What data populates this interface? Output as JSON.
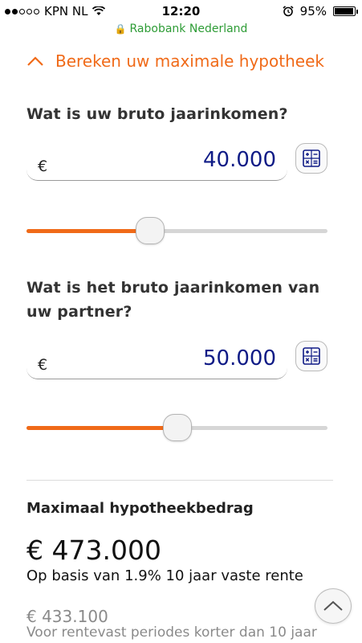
{
  "status_bar": {
    "carrier": "KPN NL",
    "time": "12:20",
    "battery": "95%",
    "battery_level": 0.95
  },
  "url_bar": {
    "site": "Rabobank Nederland"
  },
  "colors": {
    "accent": "#f06a18",
    "value_blue": "#0f1b86",
    "secure_green": "#2e9c36"
  },
  "section": {
    "title": "Bereken uw maximale hypotheek"
  },
  "income": {
    "question": "Wat is uw bruto jaarinkomen?",
    "currency": "€",
    "value": "40.000",
    "slider_fraction": 0.41
  },
  "partner_income": {
    "question": "Wat is het bruto jaarinkomen van uw partner?",
    "currency": "€",
    "value": "50.000",
    "slider_fraction": 0.5
  },
  "result": {
    "title": "Maximaal hypotheekbedrag",
    "amount": "€ 473.000",
    "basis": "Op basis van 1.9% 10 jaar vaste rente",
    "alt_amount": "€ 433.100",
    "alt_note": "Voor rentevast periodes korter dan 10 jaar"
  },
  "icons": {
    "calculator": "calculator-icon",
    "collapse": "chevron-up-icon",
    "scroll_top": "chevron-up-icon"
  }
}
